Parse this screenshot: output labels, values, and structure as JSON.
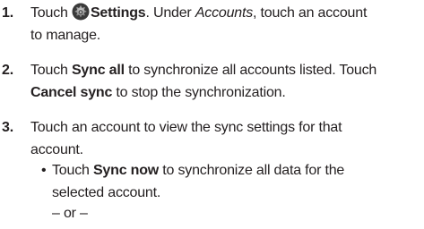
{
  "steps": [
    {
      "number": "1.",
      "parts": {
        "a": "Touch ",
        "b_icon": "settings-gear-icon",
        "c_bold": "Settings",
        "d": ". Under ",
        "e_italic": "Accounts",
        "f": ", touch an account",
        "g": "to manage."
      }
    },
    {
      "number": "2.",
      "parts": {
        "a": "Touch ",
        "b_bold": "Sync all",
        "c": " to synchronize all accounts listed. Touch",
        "d_bold": "Cancel sync",
        "e": " to stop the synchronization."
      }
    },
    {
      "number": "3.",
      "parts": {
        "a": "Touch an account to view the sync settings for that",
        "b": "account."
      },
      "bullet": {
        "dot": "•",
        "a": "Touch ",
        "b_bold": "Sync now",
        "c": " to synchronize all data for the",
        "d": "selected account."
      },
      "or": "– or –"
    }
  ]
}
